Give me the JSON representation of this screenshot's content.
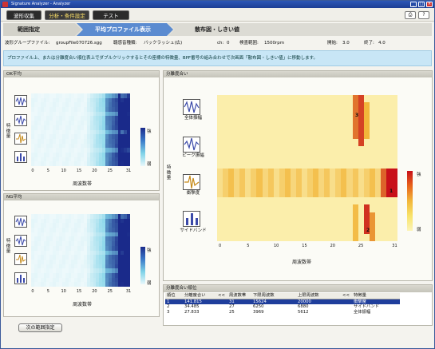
{
  "window": {
    "title": "Signature Analyzer - Analyzer",
    "controls": [
      "_",
      "□",
      "×"
    ]
  },
  "menu": {
    "tabs": [
      "波形収集",
      "分析・条件設定",
      "テスト"
    ],
    "active": 1,
    "icons": [
      "printer-icon",
      "help-icon"
    ]
  },
  "steps": [
    "範囲指定",
    "平均プロファイル表示",
    "散布図・しきい値"
  ],
  "info": {
    "group_label": "波形グループファイル:",
    "group_value": "groupFile070726.sgg",
    "sound_label": "聴感音種類:",
    "sound_value": "バックラッシュ(広)",
    "ch_label": "ch:",
    "ch_value": "0",
    "range_label": "検査範囲:",
    "range_value": "1500rpm",
    "start_label": "開始:",
    "start_value": "3.0",
    "end_label": "終了:",
    "end_value": "4.0"
  },
  "notice": "プロファイル上、または分離度合い順位表上でダブルクリックするとその座標の特徴量、BPF番号の組み合わせで次画面「散布図・しきい値」に移動します。",
  "ok_panel": {
    "title": "OK平均",
    "ylabel": "特徴量",
    "xlabel": "周波数帯",
    "ticks": [
      "0",
      "5",
      "10",
      "15",
      "20",
      "25",
      "31"
    ],
    "cbar_high": "強",
    "cbar_low": "弱"
  },
  "ng_panel": {
    "title": "NG平均",
    "ylabel": "特徴量",
    "xlabel": "周波数帯",
    "ticks": [
      "0",
      "5",
      "10",
      "15",
      "20",
      "25",
      "31"
    ],
    "cbar_high": "強",
    "cbar_low": "弱"
  },
  "sep_panel": {
    "title": "分離度合い",
    "ylabel": "特徴量",
    "xlabel": "周波数帯",
    "ticks": [
      "0",
      "5",
      "10",
      "15",
      "20",
      "25",
      "31"
    ],
    "features": [
      "全体振幅",
      "ピーク振幅",
      "衝撃度",
      "サイドバンド"
    ],
    "cell_labels": [
      "3",
      "1",
      "2"
    ],
    "cbar_high": "強",
    "cbar_low": "弱"
  },
  "colors": {
    "blue_low": "#e8f8fb",
    "blue_high": "#1a2a8a",
    "sep_low": "#fcf4b8",
    "sep_high": "#c8101a",
    "title_bar": "#2d57b8",
    "selected_row": "#1f3e9c"
  },
  "rank": {
    "title": "分離度合い順位",
    "headers": [
      "順位",
      "分離度合い",
      "<<",
      "周波数帯",
      "下限周波数",
      "上限周波数",
      "<<",
      "特徴量"
    ],
    "rows": [
      [
        "1",
        "141.815",
        "",
        "31",
        "15624",
        "20000",
        "",
        "衝撃度"
      ],
      [
        "2",
        "34.485",
        "",
        "27",
        "6250",
        "6880",
        "",
        "サイドバンド"
      ],
      [
        "3",
        "27.833",
        "",
        "25",
        "3969",
        "5612",
        "",
        "全体振幅"
      ]
    ]
  },
  "next_button": "次の範囲指定"
}
